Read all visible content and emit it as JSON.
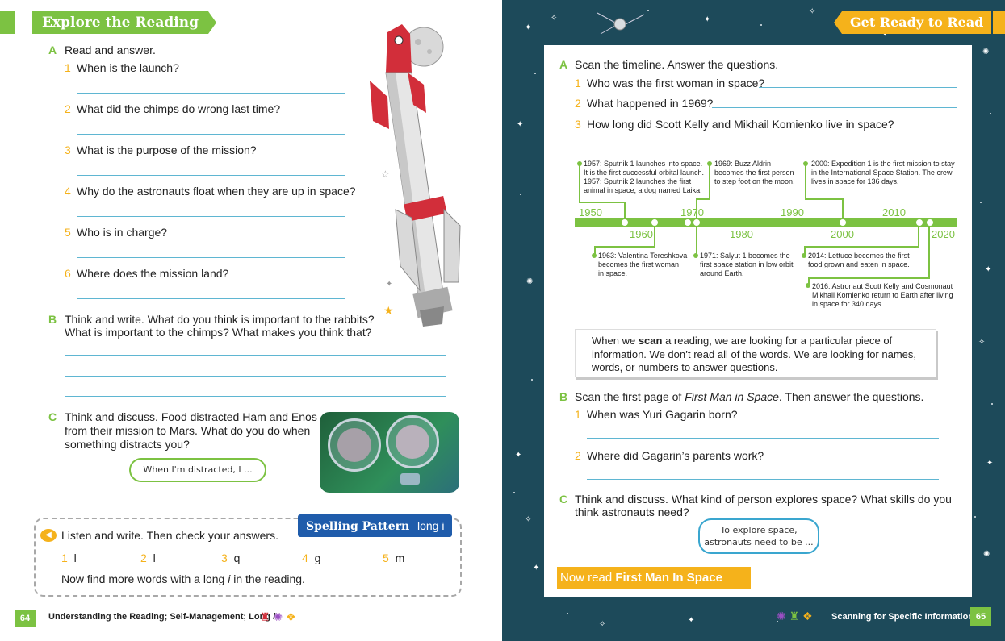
{
  "left": {
    "banner": "Explore the Reading",
    "section_a": {
      "letter": "A",
      "instruction": "Read and answer.",
      "questions": [
        {
          "num": "1",
          "text": "When is the launch?"
        },
        {
          "num": "2",
          "text": "What did the chimps do wrong last time?"
        },
        {
          "num": "3",
          "text": "What is the purpose of the mission?"
        },
        {
          "num": "4",
          "text": "Why do the astronauts float when they are up in space?"
        },
        {
          "num": "5",
          "text": "Who is in charge?"
        },
        {
          "num": "6",
          "text": "Where does the mission land?"
        }
      ]
    },
    "section_b": {
      "letter": "B",
      "line1": "Think and write. What do you think is important to the rabbits?",
      "line2": "What is important to the chimps? What makes you think that?"
    },
    "section_c": {
      "letter": "C",
      "line1": "Think and discuss. Food distracted Ham and Enos",
      "line2": "from their mission to Mars. What do you do when",
      "line3": "something distracts you?",
      "bubble": "When I'm distracted, I ..."
    },
    "spelling": {
      "tag": "Spelling Pattern",
      "tag_sub": "long i",
      "instruction": "Listen and write. Then check your answers.",
      "items": [
        {
          "num": "1",
          "start": "l"
        },
        {
          "num": "2",
          "start": "l"
        },
        {
          "num": "3",
          "start": "q"
        },
        {
          "num": "4",
          "start": "g"
        },
        {
          "num": "5",
          "start": "m"
        }
      ],
      "footer_pre": "Now find more words with a long ",
      "footer_em": "i",
      "footer_post": " in the reading."
    },
    "footer": {
      "page": "64",
      "text_pre": "Understanding the Reading; Self-Management; Long ",
      "text_em": "i"
    }
  },
  "right": {
    "banner": "Get Ready to Read",
    "section_a": {
      "letter": "A",
      "instruction": "Scan the timeline. Answer the questions.",
      "questions": [
        {
          "num": "1",
          "text": "Who was the first woman in space?"
        },
        {
          "num": "2",
          "text": "What happened in 1969?"
        },
        {
          "num": "3",
          "text": "How long did Scott Kelly and Mikhail Komienko live in space?"
        }
      ]
    },
    "timeline": {
      "years_top": [
        "1950",
        "1970",
        "1990",
        "2010"
      ],
      "years_bottom": [
        "1960",
        "1980",
        "2000",
        "2020"
      ],
      "events_top": [
        {
          "l1": "1957: Sputnik 1 launches into space.",
          "l2": "It is the first successful orbital launch.",
          "l3": "1957: Sputnik 2 launches the first",
          "l4": "animal in space, a dog named Laika."
        },
        {
          "l1": "1969: Buzz Aldrin",
          "l2": "becomes the first person",
          "l3": "to step foot on the moon."
        },
        {
          "l1": "2000: Expedition 1 is the first mission to stay",
          "l2": "in the International Space Station. The crew",
          "l3": "lives in space for 136 days."
        }
      ],
      "events_bottom": [
        {
          "l1": "1963: Valentina Tereshkova",
          "l2": "becomes the first woman",
          "l3": "in space."
        },
        {
          "l1": "1971: Salyut 1 becomes the",
          "l2": "first space station in low orbit",
          "l3": "around Earth."
        },
        {
          "l1": "2014: Lettuce becomes the first",
          "l2": "food grown and eaten in space."
        },
        {
          "l1": "2016: Astronaut Scott Kelly and Cosmonaut",
          "l2": "Mikhail Kornienko return to Earth after living",
          "l3": "in space for 340 days."
        }
      ]
    },
    "tip": {
      "pre": "When we ",
      "bold": "scan",
      "post": " a reading, we are looking for a particular piece of information. We don’t read all of the words. We are looking for names, words, or numbers to answer questions."
    },
    "section_b": {
      "letter": "B",
      "pre": "Scan the first page of ",
      "em": "First Man in Space",
      "post": ". Then answer the questions.",
      "questions": [
        {
          "num": "1",
          "text": "When was Yuri Gagarin born?"
        },
        {
          "num": "2",
          "text": "Where did Gagarin’s parents work?"
        }
      ]
    },
    "section_c": {
      "letter": "C",
      "line1": "Think and discuss. What kind of person explores space? What skills do you",
      "line2": "think astronauts need?",
      "bubble1": "To explore space,",
      "bubble2": "astronauts need to be ..."
    },
    "now_read": {
      "pre": "Now read ",
      "bold": "First Man In Space"
    },
    "footer": {
      "page": "65",
      "text": "Scanning for Specific Information"
    }
  }
}
